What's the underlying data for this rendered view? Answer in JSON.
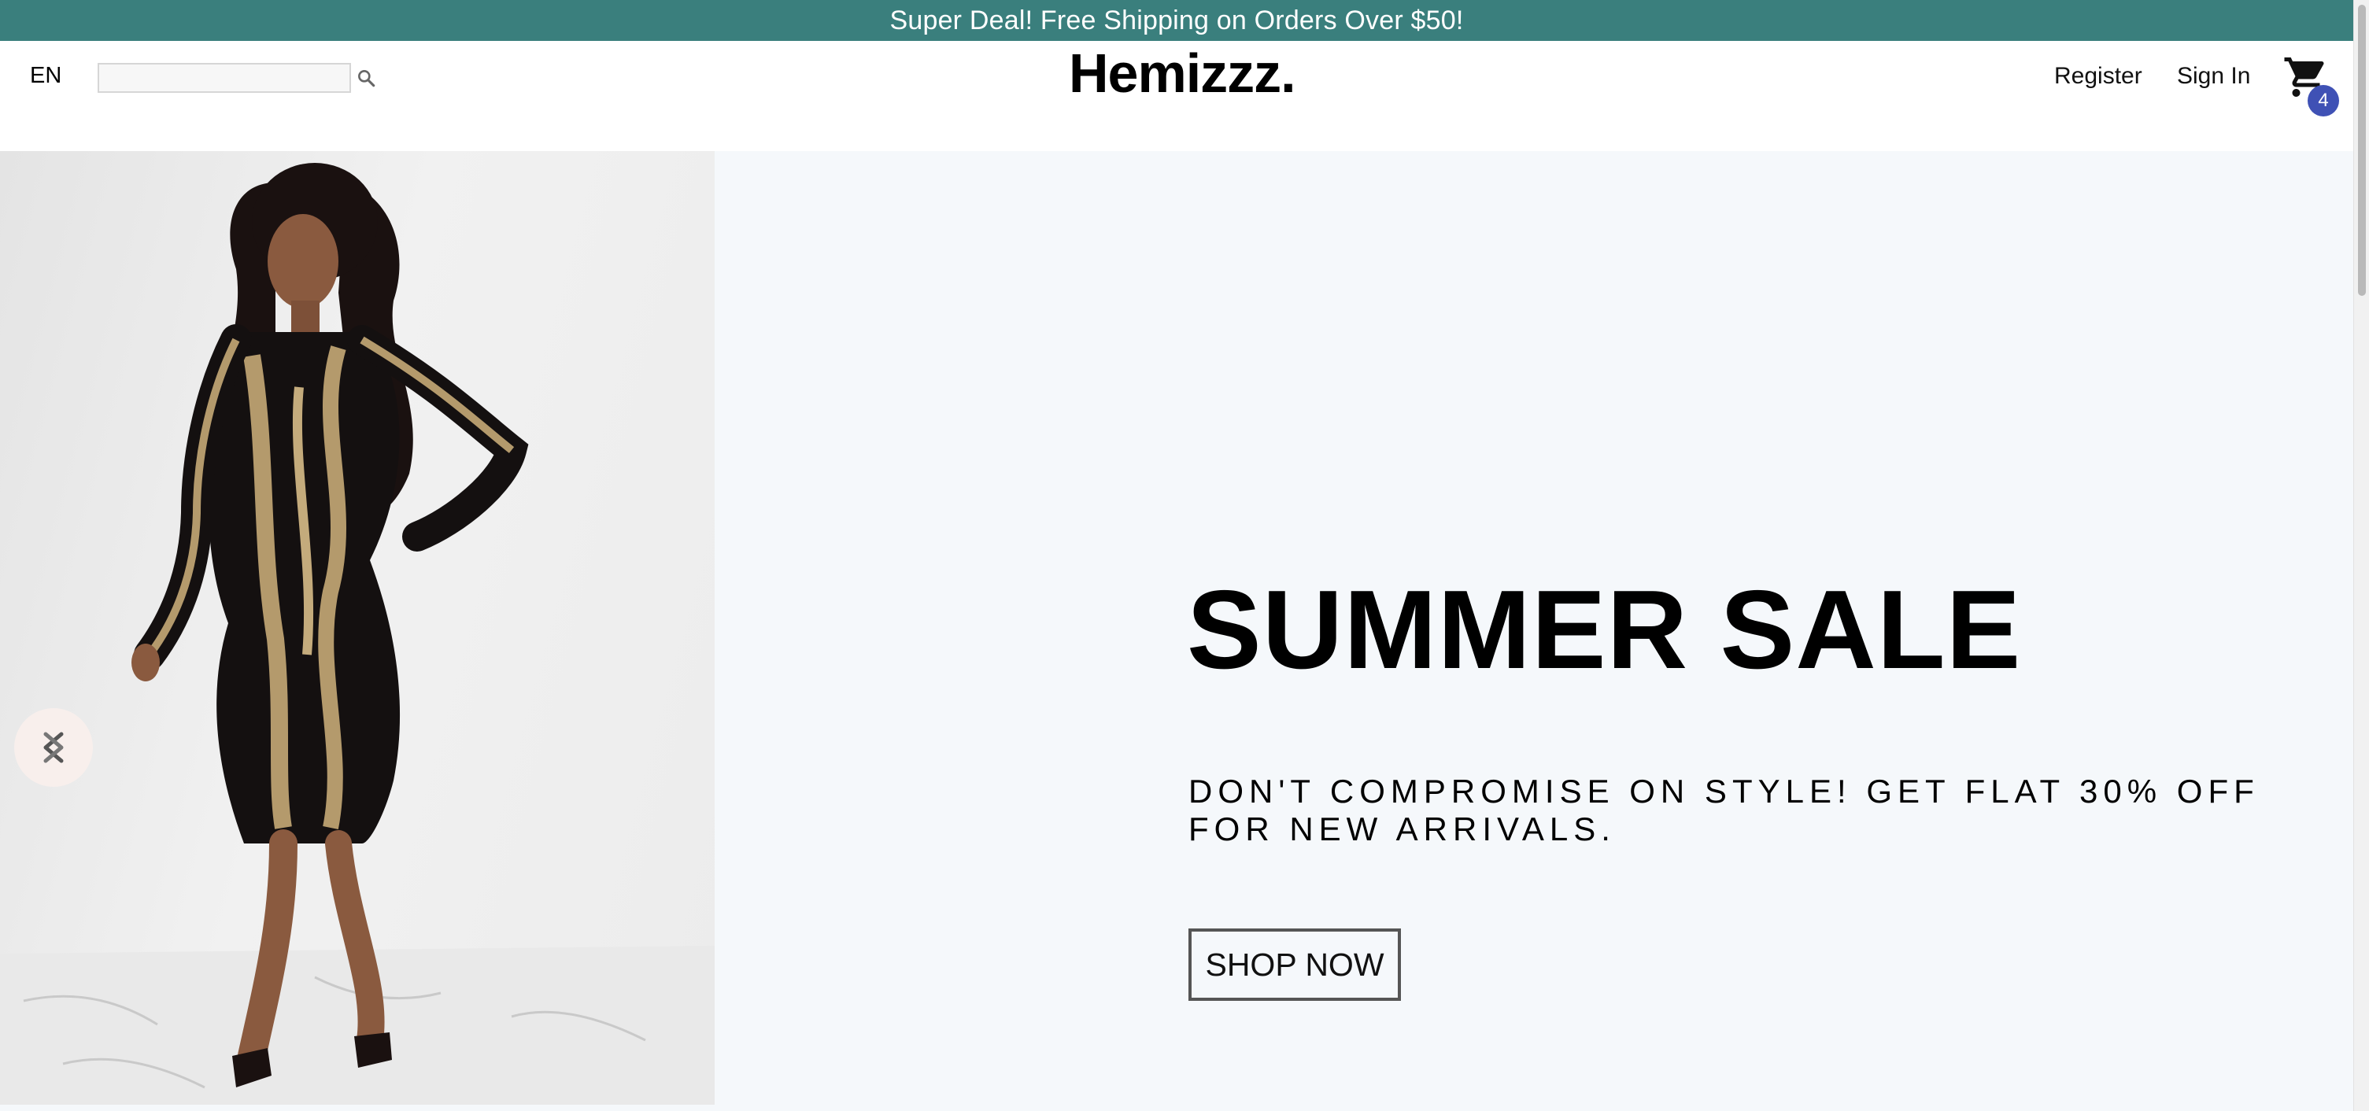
{
  "announcement": {
    "text": "Super Deal! Free Shipping on Orders Over $50!",
    "background": "#3a7f7d"
  },
  "header": {
    "language": "EN",
    "search": {
      "placeholder": "",
      "value": "",
      "icon": "search-icon"
    },
    "logo": "Hemizzz.",
    "links": {
      "register": "Register",
      "sign_in": "Sign In"
    },
    "cart": {
      "icon": "cart-icon",
      "count": "4",
      "badge_color": "#3f51b5"
    }
  },
  "hero": {
    "title": "SUMMER SALE",
    "subtitle": "DON'T COMPROMISE ON STYLE! GET FLAT 30% OFF FOR NEW ARRIVALS.",
    "button_label": "SHOP NOW",
    "image": "model-in-sequin-dress",
    "slider_arrow_icon": "chevron-left-icon",
    "background": "#f5f8fb"
  }
}
